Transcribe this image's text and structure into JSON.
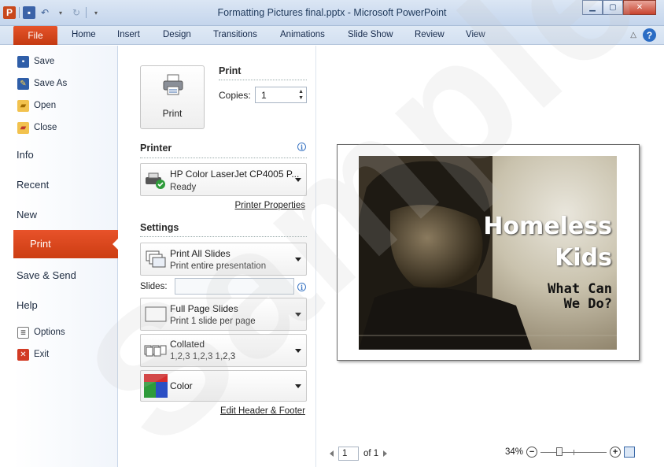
{
  "window": {
    "title": "Formatting Pictures final.pptx - Microsoft PowerPoint",
    "app_icon": "P"
  },
  "ribbon": {
    "tabs": [
      "File",
      "Home",
      "Insert",
      "Design",
      "Transitions",
      "Animations",
      "Slide Show",
      "Review",
      "View"
    ]
  },
  "nav": {
    "save": "Save",
    "save_as": "Save As",
    "open": "Open",
    "close": "Close",
    "info": "Info",
    "recent": "Recent",
    "new": "New",
    "print": "Print",
    "save_send": "Save & Send",
    "help": "Help",
    "options": "Options",
    "exit": "Exit"
  },
  "print_panel": {
    "print_heading": "Print",
    "print_button": "Print",
    "copies_label": "Copies:",
    "copies_value": "1",
    "printer_heading": "Printer",
    "printer_name": "HP Color LaserJet CP4005 P...",
    "printer_status": "Ready",
    "printer_properties": "Printer Properties",
    "settings_heading": "Settings",
    "range_title": "Print All Slides",
    "range_sub": "Print entire presentation",
    "slides_label": "Slides:",
    "slides_value": "",
    "layout_title": "Full Page Slides",
    "layout_sub": "Print 1 slide per page",
    "collate_title": "Collated",
    "collate_sub": "1,2,3   1,2,3   1,2,3",
    "color_title": "Color",
    "edit_header_footer": "Edit Header & Footer"
  },
  "preview": {
    "slide_title_1": "Homeless",
    "slide_title_2": "Kids",
    "slide_subtitle_1": "What Can",
    "slide_subtitle_2": "We Do?",
    "page_current": "1",
    "page_total": "of 1",
    "zoom": "34%"
  },
  "watermark": "Sample",
  "colors": {
    "file_tab": "#d2461a",
    "print_selected": "#dc4a1e",
    "titlebar": "#d0ddef"
  }
}
